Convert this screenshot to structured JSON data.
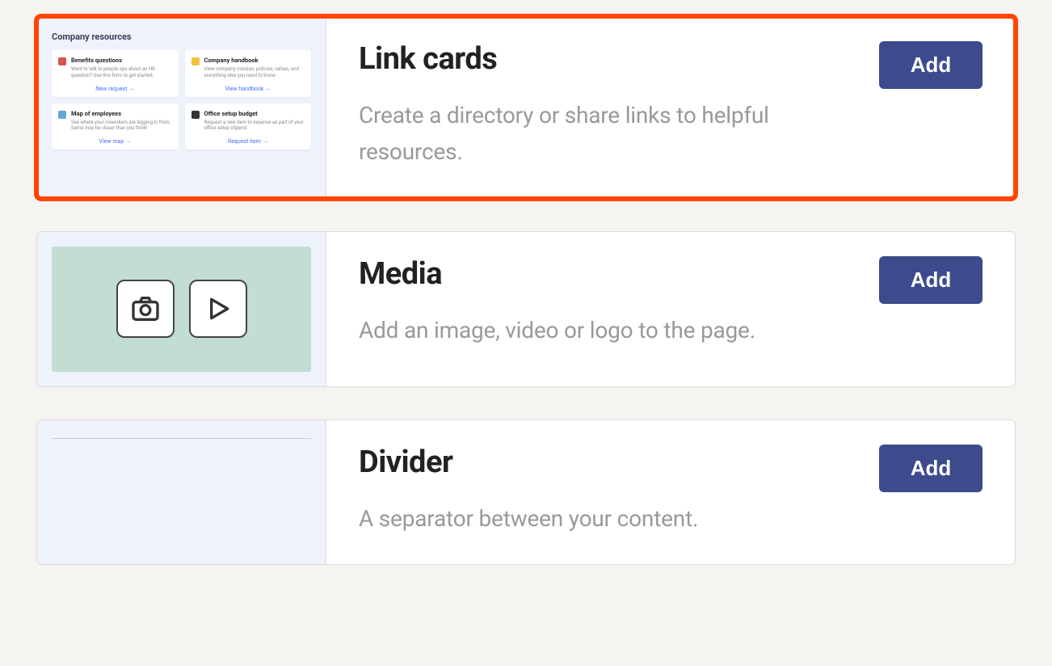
{
  "options": [
    {
      "id": "link-cards",
      "title": "Link cards",
      "description": "Create a directory or share links to helpful resources.",
      "add_label": "Add",
      "highlighted": true,
      "preview": {
        "heading": "Company resources",
        "cards": [
          {
            "title": "Benefits questions",
            "desc": "Want to talk to people ops about an HR question? Use this form to get started.",
            "link": "New request →",
            "icon_color": "#d9534f"
          },
          {
            "title": "Company handbook",
            "desc": "View company mission, policies, values, and everything else you need to know.",
            "link": "View handbook →",
            "icon_color": "#f0c244"
          },
          {
            "title": "Map of employees",
            "desc": "See where your coworkers are logging in from. Some may be closer than you think!",
            "link": "View map →",
            "icon_color": "#5fa8d3"
          },
          {
            "title": "Office setup budget",
            "desc": "Request a new item to expense as part of your office setup stipend.",
            "link": "Request item →",
            "icon_color": "#333333"
          }
        ]
      }
    },
    {
      "id": "media",
      "title": "Media",
      "description": "Add an image, video or logo to the page.",
      "add_label": "Add",
      "highlighted": false
    },
    {
      "id": "divider",
      "title": "Divider",
      "description": "A separator between your content.",
      "add_label": "Add",
      "highlighted": false
    }
  ]
}
